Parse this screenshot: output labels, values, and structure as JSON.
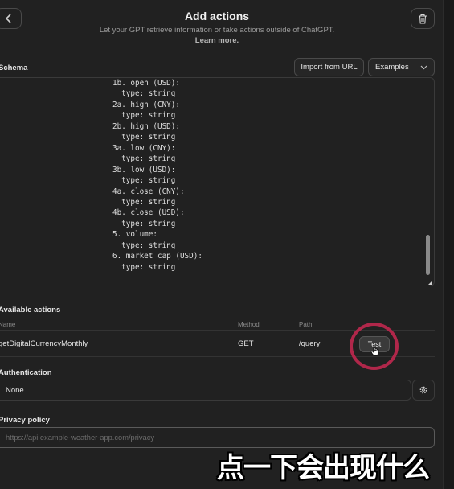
{
  "header": {
    "title": "Add actions",
    "subtitle": "Let your GPT retrieve information or take actions outside of ChatGPT.",
    "learn_more": "Learn more."
  },
  "schema": {
    "label": "Schema",
    "import_label": "Import from URL",
    "examples_label": "Examples",
    "lines": [
      "1b. open (USD):",
      "  type: string",
      "2a. high (CNY):",
      "  type: string",
      "2b. high (USD):",
      "  type: string",
      "3a. low (CNY):",
      "  type: string",
      "3b. low (USD):",
      "  type: string",
      "4a. close (CNY):",
      "  type: string",
      "4b. close (USD):",
      "  type: string",
      "5. volume:",
      "  type: string",
      "6. market cap (USD):",
      "  type: string"
    ]
  },
  "actions": {
    "label": "Available actions",
    "columns": {
      "name": "Name",
      "method": "Method",
      "path": "Path"
    },
    "rows": [
      {
        "name": "getDigitalCurrencyMonthly",
        "method": "GET",
        "path": "/query",
        "test_label": "Test"
      }
    ]
  },
  "authentication": {
    "label": "Authentication",
    "value": "None"
  },
  "privacy": {
    "label": "Privacy policy",
    "placeholder": "https://api.example-weather-app.com/privacy"
  },
  "caption": "点一下会出现什么",
  "colors": {
    "background": "#212121",
    "highlight_ring": "#b0274a"
  },
  "icons": [
    "chevron-left-icon",
    "trash-icon",
    "chevron-down-icon",
    "gear-icon",
    "pointer-cursor-icon"
  ]
}
